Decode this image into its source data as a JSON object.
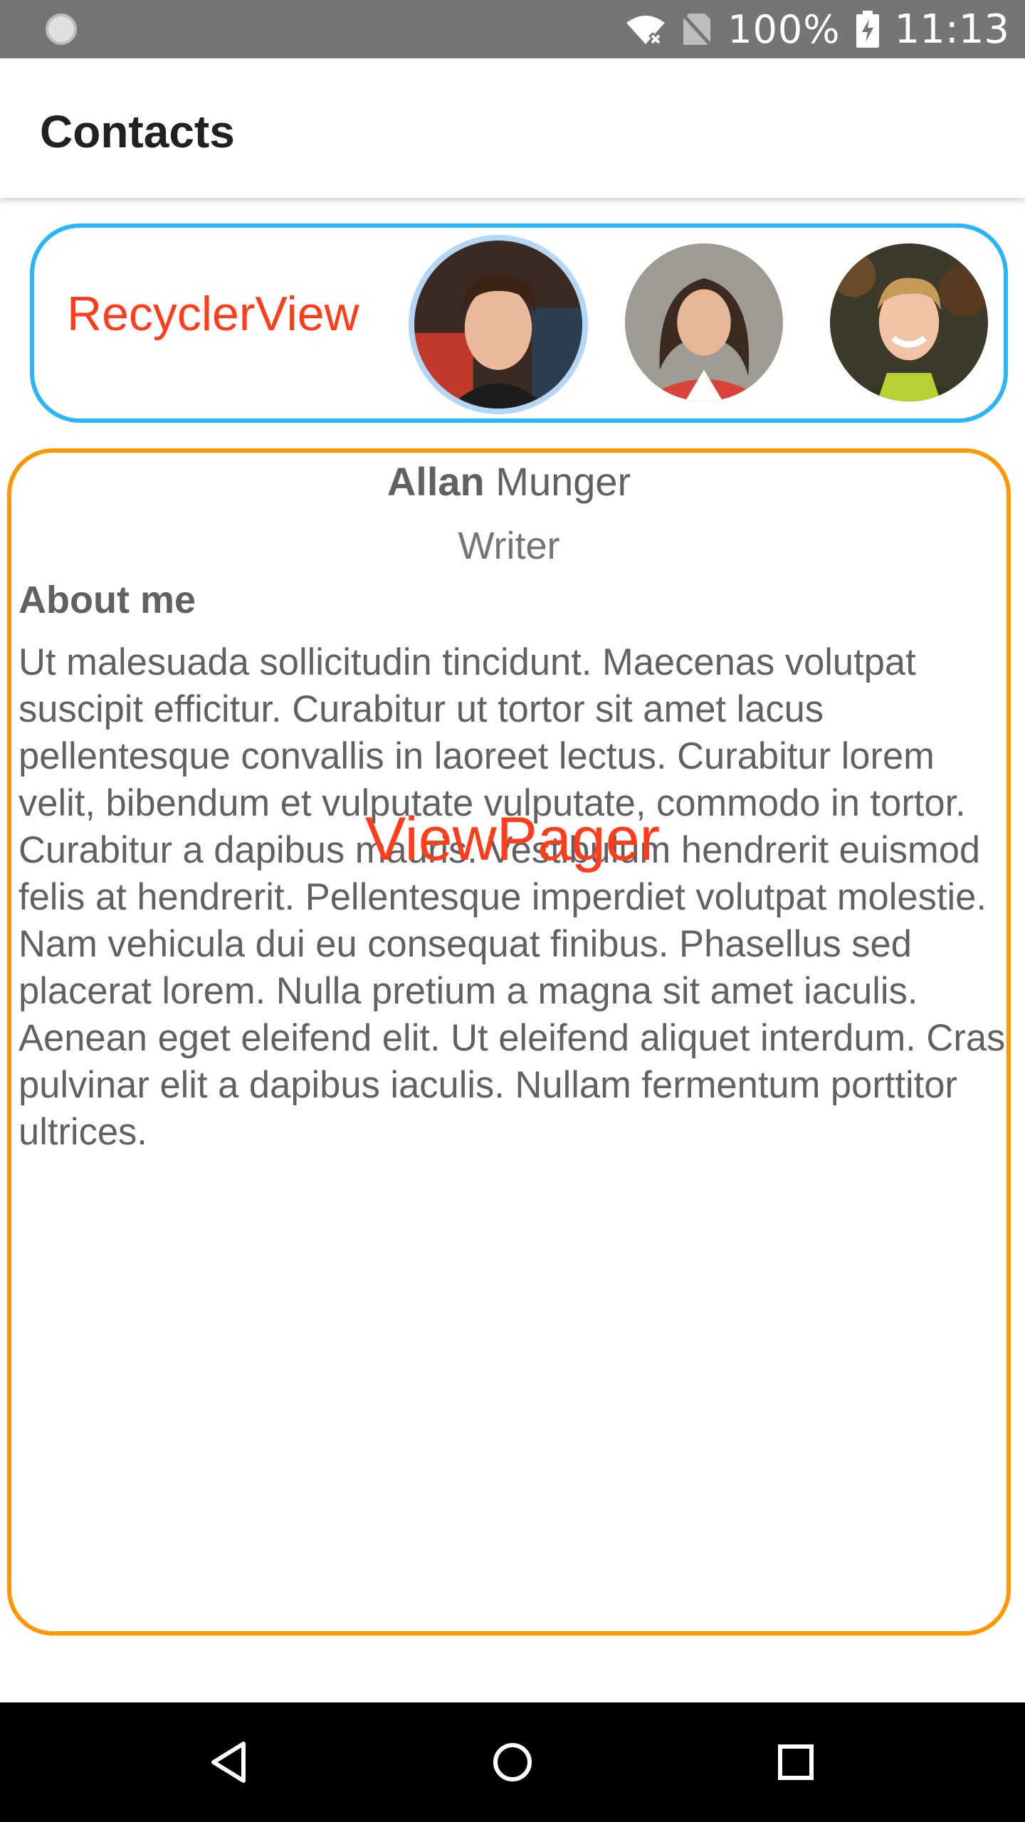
{
  "status_bar": {
    "battery_percent": "100%",
    "time": "11:13",
    "icons": [
      "sync-icon",
      "wifi-icon",
      "no-sim-icon",
      "battery-charging-icon"
    ]
  },
  "app_bar": {
    "title": "Contacts"
  },
  "recycler": {
    "label": "RecyclerView",
    "accent": "#29b6f6",
    "avatars": [
      "avatar-allan",
      "avatar-woman",
      "avatar-man"
    ]
  },
  "profile": {
    "first_name": "Allan",
    "last_name": "Munger",
    "job": "Writer",
    "about_title": "About me",
    "about_text": "Ut malesuada sollicitudin tincidunt. Maecenas volutpat suscipit efficitur. Curabitur ut tortor sit amet lacus pellentesque convallis in laoreet lectus. Curabitur lorem velit, bibendum et vulputate vulputate, commodo in tortor. Curabitur a dapibus mauris. Vestibulum hendrerit euismod felis at hendrerit. Pellentesque imperdiet volutpat molestie. Nam vehicula dui eu consequat finibus. Phasellus sed placerat lorem. Nulla pretium a magna sit amet iaculis. Aenean eget eleifend elit. Ut eleifend aliquet interdum. Cras pulvinar elit a dapibus iaculis. Nullam fermentum porttitor ultrices."
  },
  "viewpager": {
    "label": "ViewPager",
    "accent": "#ff9800"
  },
  "nav_bar": {
    "buttons": [
      "back-icon",
      "home-icon",
      "recents-icon"
    ]
  },
  "colors": {
    "annotation_red": "#ff3d1a",
    "status_bar": "#757575"
  }
}
